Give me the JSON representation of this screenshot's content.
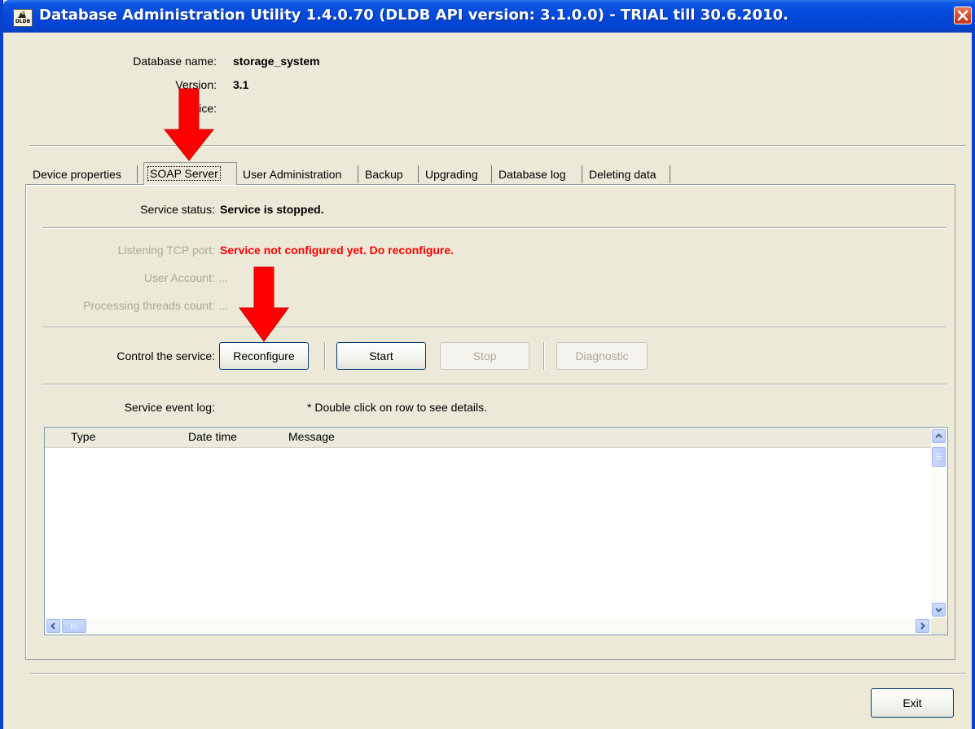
{
  "window": {
    "title": "Database Administration Utility  1.4.0.70  (DLDB API version: 3.1.0.0) - TRIAL till 30.6.2010.",
    "icon_text": "DLDB",
    "icon": "dldb-app-icon",
    "close_icon": "close-icon"
  },
  "database_info": {
    "name_label": "Database name:",
    "name_value": "storage_system",
    "version_label": "Version:",
    "version_value": "3.1",
    "notice_label": "Notice:",
    "notice_value": ""
  },
  "tabs": [
    {
      "label": "Device properties",
      "active": false
    },
    {
      "label": "SOAP Server",
      "active": true
    },
    {
      "label": "User Administration",
      "active": false
    },
    {
      "label": "Backup",
      "active": false
    },
    {
      "label": "Upgrading",
      "active": false
    },
    {
      "label": "Database log",
      "active": false
    },
    {
      "label": "Deleting data",
      "active": false
    }
  ],
  "soap_server": {
    "status_label": "Service status:",
    "status_value": "Service is stopped.",
    "port_label": "Listening TCP port:",
    "port_value": "Service not configured yet. Do reconfigure.",
    "account_label": "User Account:",
    "account_value": "...",
    "threads_label": "Processing threads count:",
    "threads_value": "...",
    "control_label": "Control the service:",
    "buttons": {
      "reconfigure": "Reconfigure",
      "start": "Start",
      "stop": "Stop",
      "diagnostic": "Diagnostic"
    },
    "log_label": "Service event log:",
    "log_hint": "* Double click on row to see details.",
    "log_columns": [
      "Type",
      "Date time",
      "Message"
    ],
    "log_rows": []
  },
  "footer": {
    "exit_label": "Exit"
  },
  "colors": {
    "titlebar": "#0448d8",
    "error_text": "#ff0000",
    "annotation_arrow": "#ff0000",
    "dialog_bg": "#ece9d8"
  }
}
